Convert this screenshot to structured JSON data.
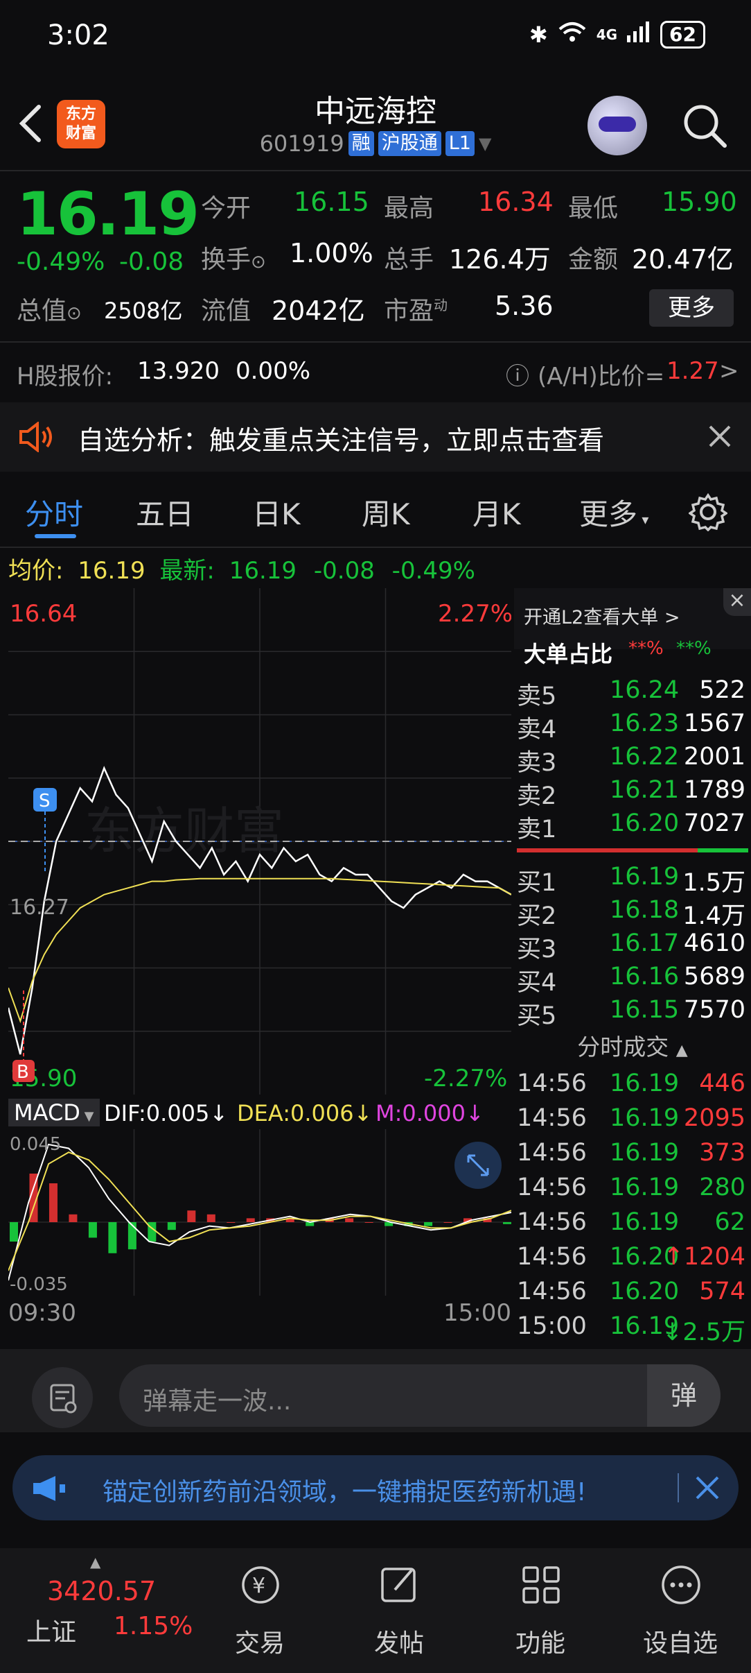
{
  "status_bar": {
    "time": "3:02",
    "network": "4G",
    "battery": "62"
  },
  "header": {
    "logo_line1": "东方",
    "logo_line2": "财富",
    "title": "中远海控",
    "code": "601919",
    "tags": [
      "融",
      "沪股通",
      "L1"
    ]
  },
  "quote": {
    "price": "16.19",
    "change_pct": "-0.49%",
    "change": "-0.08",
    "open_label": "今开",
    "open": "16.15",
    "high_label": "最高",
    "high": "16.34",
    "low_label": "最低",
    "low": "15.90",
    "turnover_label": "换手",
    "turnover": "1.00%",
    "volume_label": "总手",
    "volume": "126.4万",
    "amount_label": "金额",
    "amount": "20.47亿",
    "mktcap_label": "总值",
    "mktcap": "2508亿",
    "float_label": "流值",
    "float": "2042亿",
    "pe_label": "市盈",
    "pe_sup": "动",
    "pe": "5.36",
    "more_button": "更多"
  },
  "h_share": {
    "label": "H股报价:",
    "price": "13.920",
    "pct": "0.00%",
    "ratio_label": "(A/H)比价=",
    "ratio": "1.27",
    "arrow": ">"
  },
  "banner": {
    "text": "自选分析：触发重点关注信号，立即点击查看"
  },
  "tabs": [
    "分时",
    "五日",
    "日K",
    "周K",
    "月K",
    "更多"
  ],
  "avg_line": {
    "avg_label": "均价:",
    "avg_value": "16.19",
    "latest_label": "最新:",
    "latest_value": "16.19",
    "latest_change": "-0.08",
    "latest_pct": "-0.49%"
  },
  "chart_labels": {
    "top_price": "16.64",
    "top_pct": "2.27%",
    "bottom_price": "15.90",
    "bottom_pct": "-2.27%",
    "dash_price": "16.27",
    "marker_sell": "S",
    "marker_buy": "B",
    "watermark": "东方财富",
    "time_start": "09:30",
    "time_end": "15:00"
  },
  "macd": {
    "selector": "MACD",
    "dif": "DIF:0.005",
    "dea": "DEA:0.006",
    "m": "M:0.000",
    "top_value": "0.045",
    "bottom_value": "-0.035",
    "arrow": "↓"
  },
  "chart_data": {
    "type": "line",
    "title": "",
    "x_range": [
      "09:30",
      "15:00"
    ],
    "ylim": [
      15.9,
      16.64
    ],
    "series": [
      {
        "name": "",
        "color": "#ffffff",
        "y": [
          16.02,
          15.95,
          16.05,
          16.18,
          16.27,
          16.31,
          16.35,
          16.33,
          16.38,
          16.34,
          16.32,
          16.28,
          16.24,
          16.3,
          16.27,
          16.25,
          16.23,
          16.26,
          16.22,
          16.24,
          16.21,
          16.25,
          16.23,
          16.26,
          16.24,
          16.25,
          16.22,
          16.21,
          16.23,
          16.22,
          16.22,
          16.2,
          16.18,
          16.17,
          16.19,
          16.2,
          16.21,
          16.2,
          16.22,
          16.21,
          16.21,
          16.2,
          16.19
        ]
      },
      {
        "name": "",
        "color": "#f0e055",
        "y": [
          16.05,
          16.0,
          16.06,
          16.1,
          16.13,
          16.15,
          16.17,
          16.18,
          16.19,
          16.195,
          16.2,
          16.205,
          16.21,
          16.21,
          16.212,
          16.213,
          16.214,
          16.214,
          16.214,
          16.214,
          16.214,
          16.214,
          16.214,
          16.214,
          16.214,
          16.214,
          16.214,
          16.214,
          16.213,
          16.212,
          16.211,
          16.21,
          16.209,
          16.208,
          16.207,
          16.206,
          16.205,
          16.204,
          16.203,
          16.202,
          16.201,
          16.2,
          16.19
        ]
      }
    ],
    "macd_ylim": [
      -0.035,
      0.045
    ],
    "macd_series": {
      "dif": [
        -0.03,
        0.01,
        0.04,
        0.038,
        0.028,
        0.012,
        0.0,
        -0.01,
        -0.012,
        -0.005,
        -0.002,
        -0.003,
        -0.001,
        0.001,
        0.003,
        0.0,
        0.002,
        0.004,
        0.003,
        0.0,
        -0.002,
        -0.004,
        -0.003,
        0.001,
        0.003,
        0.005
      ],
      "dea": [
        -0.025,
        0.0,
        0.03,
        0.036,
        0.032,
        0.022,
        0.01,
        -0.002,
        -0.01,
        -0.008,
        -0.004,
        -0.003,
        -0.002,
        0.0,
        0.002,
        0.001,
        0.001,
        0.003,
        0.003,
        0.001,
        -0.001,
        -0.003,
        -0.003,
        0.0,
        0.002,
        0.006
      ],
      "hist": [
        -0.01,
        0.025,
        0.02,
        0.004,
        -0.008,
        -0.016,
        -0.014,
        -0.01,
        -0.004,
        0.006,
        0.004,
        0.0,
        0.002,
        0.002,
        0.002,
        -0.002,
        0.002,
        0.002,
        0.0,
        -0.002,
        -0.002,
        -0.002,
        0.0,
        0.002,
        0.002,
        -0.001
      ]
    }
  },
  "orderbook": {
    "close_icon": "×",
    "l2_link": "开通L2查看大单",
    "chevron": ">",
    "big_order_label": "大单占比",
    "big_red": "**%",
    "big_green": "**%",
    "asks": [
      {
        "label": "卖5",
        "price": "16.24",
        "vol": "522"
      },
      {
        "label": "卖4",
        "price": "16.23",
        "vol": "1567"
      },
      {
        "label": "卖3",
        "price": "16.22",
        "vol": "2001"
      },
      {
        "label": "卖2",
        "price": "16.21",
        "vol": "1789"
      },
      {
        "label": "卖1",
        "price": "16.20",
        "vol": "7027"
      }
    ],
    "bids": [
      {
        "label": "买1",
        "price": "16.19",
        "vol": "1.5万"
      },
      {
        "label": "买2",
        "price": "16.18",
        "vol": "1.4万"
      },
      {
        "label": "买3",
        "price": "16.17",
        "vol": "4610"
      },
      {
        "label": "买4",
        "price": "16.16",
        "vol": "5689"
      },
      {
        "label": "买5",
        "price": "16.15",
        "vol": "7570"
      }
    ],
    "trades_label": "分时成交",
    "trades": [
      {
        "time": "14:56",
        "price": "16.19",
        "vol": "446",
        "color": "#ff3b3b"
      },
      {
        "time": "14:56",
        "price": "16.19",
        "vol": "2095",
        "color": "#ff3b3b"
      },
      {
        "time": "14:56",
        "price": "16.19",
        "vol": "373",
        "color": "#ff3b3b"
      },
      {
        "time": "14:56",
        "price": "16.19",
        "vol": "280",
        "color": "#17c23a"
      },
      {
        "time": "14:56",
        "price": "16.19",
        "vol": "62",
        "color": "#17c23a"
      },
      {
        "time": "14:56",
        "price": "16.20",
        "vol": "↑1204",
        "color": "#ff3b3b"
      },
      {
        "time": "14:56",
        "price": "16.20",
        "vol": "574",
        "color": "#ff3b3b"
      },
      {
        "time": "15:00",
        "price": "16.19",
        "vol": "↓2.5万",
        "color": "#17c23a"
      }
    ]
  },
  "danmu": {
    "placeholder": "弹幕走一波...",
    "send_label": "弹"
  },
  "promo": {
    "text": "锚定创新药前沿领域，一键捕捉医药新机遇!"
  },
  "bottom_nav": {
    "index_value": "3420.57",
    "index_name": "上证",
    "index_pct": "1.15%",
    "items": [
      "交易",
      "发帖",
      "功能",
      "设自选"
    ]
  },
  "colors": {
    "up": "#ff3b3b",
    "down": "#17c23a",
    "accent": "#3d8ff0",
    "bg": "#0d0d0f"
  }
}
